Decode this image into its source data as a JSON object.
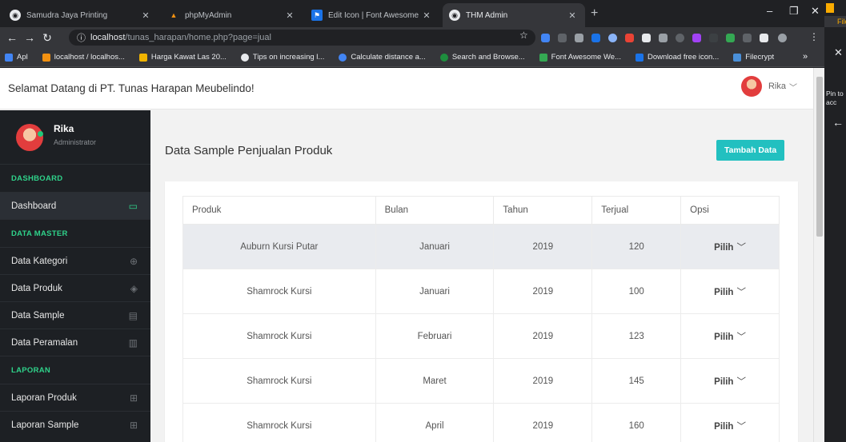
{
  "browser": {
    "tabs": [
      {
        "title": "Samudra Jaya Printing",
        "icon": "globe-icon"
      },
      {
        "title": "phpMyAdmin",
        "icon": "phpmyadmin-icon"
      },
      {
        "title": "Edit Icon | Font Awesome",
        "icon": "fontawesome-icon"
      },
      {
        "title": "THM Admin",
        "icon": "globe-icon",
        "active": true
      }
    ],
    "url_host": "localhost",
    "url_path": "/tunas_harapan/home.php?page=jual",
    "bookmarks": [
      {
        "label": "Apl",
        "color": "#4285f4"
      },
      {
        "label": "localhost / localhos...",
        "color": "#f29111"
      },
      {
        "label": "Harga Kawat Las 20...",
        "color": "#f0b400"
      },
      {
        "label": "Tips on increasing l...",
        "color": "#e8eaed"
      },
      {
        "label": "Calculate distance a...",
        "color": "#4285f4"
      },
      {
        "label": "Search and Browse...",
        "color": "#1e8e3e"
      },
      {
        "label": "Font Awesome We...",
        "color": "#34a853"
      },
      {
        "label": "Download free icon...",
        "color": "#1a73e8"
      },
      {
        "label": "Filecrypt",
        "color": "#4a90d9"
      }
    ],
    "bookmarks_more": "»",
    "side_panel": {
      "file": "File",
      "pin_line1": "Pin to",
      "pin_line2": "acc"
    }
  },
  "header": {
    "welcome": "Selamat Datang di PT. Tunas Harapan Meubelindo!",
    "user_name": "Rika"
  },
  "sidebar": {
    "profile_name": "Rika",
    "profile_role": "Administrator",
    "sections": [
      {
        "title": "DASHBOARD",
        "items": [
          {
            "label": "Dashboard",
            "icon": "monitor-icon",
            "active": true
          }
        ]
      },
      {
        "title": "DATA MASTER",
        "items": [
          {
            "label": "Data Kategori",
            "icon": "globe-icon"
          },
          {
            "label": "Data Produk",
            "icon": "layers-icon"
          },
          {
            "label": "Data Sample",
            "icon": "book-icon"
          },
          {
            "label": "Data Peramalan",
            "icon": "bar-chart-icon"
          }
        ]
      },
      {
        "title": "LAPORAN",
        "items": [
          {
            "label": "Laporan Produk",
            "icon": "grid-icon"
          },
          {
            "label": "Laporan Sample",
            "icon": "grid-icon"
          }
        ]
      }
    ]
  },
  "main": {
    "title": "Data Sample Penjualan Produk",
    "add_button": "Tambah Data",
    "table": {
      "headers": [
        "Produk",
        "Bulan",
        "Tahun",
        "Terjual",
        "Opsi"
      ],
      "rows": [
        [
          "Auburn Kursi Putar",
          "Januari",
          "2019",
          "120",
          "Pilih"
        ],
        [
          "Shamrock Kursi",
          "Januari",
          "2019",
          "100",
          "Pilih"
        ],
        [
          "Shamrock Kursi",
          "Februari",
          "2019",
          "123",
          "Pilih"
        ],
        [
          "Shamrock Kursi",
          "Maret",
          "2019",
          "145",
          "Pilih"
        ],
        [
          "Shamrock Kursi",
          "April",
          "2019",
          "160",
          "Pilih"
        ]
      ]
    }
  },
  "colors": {
    "accent": "#22c0c0",
    "sidebar_bg": "#1d2024",
    "section_green": "#2fd28a"
  }
}
